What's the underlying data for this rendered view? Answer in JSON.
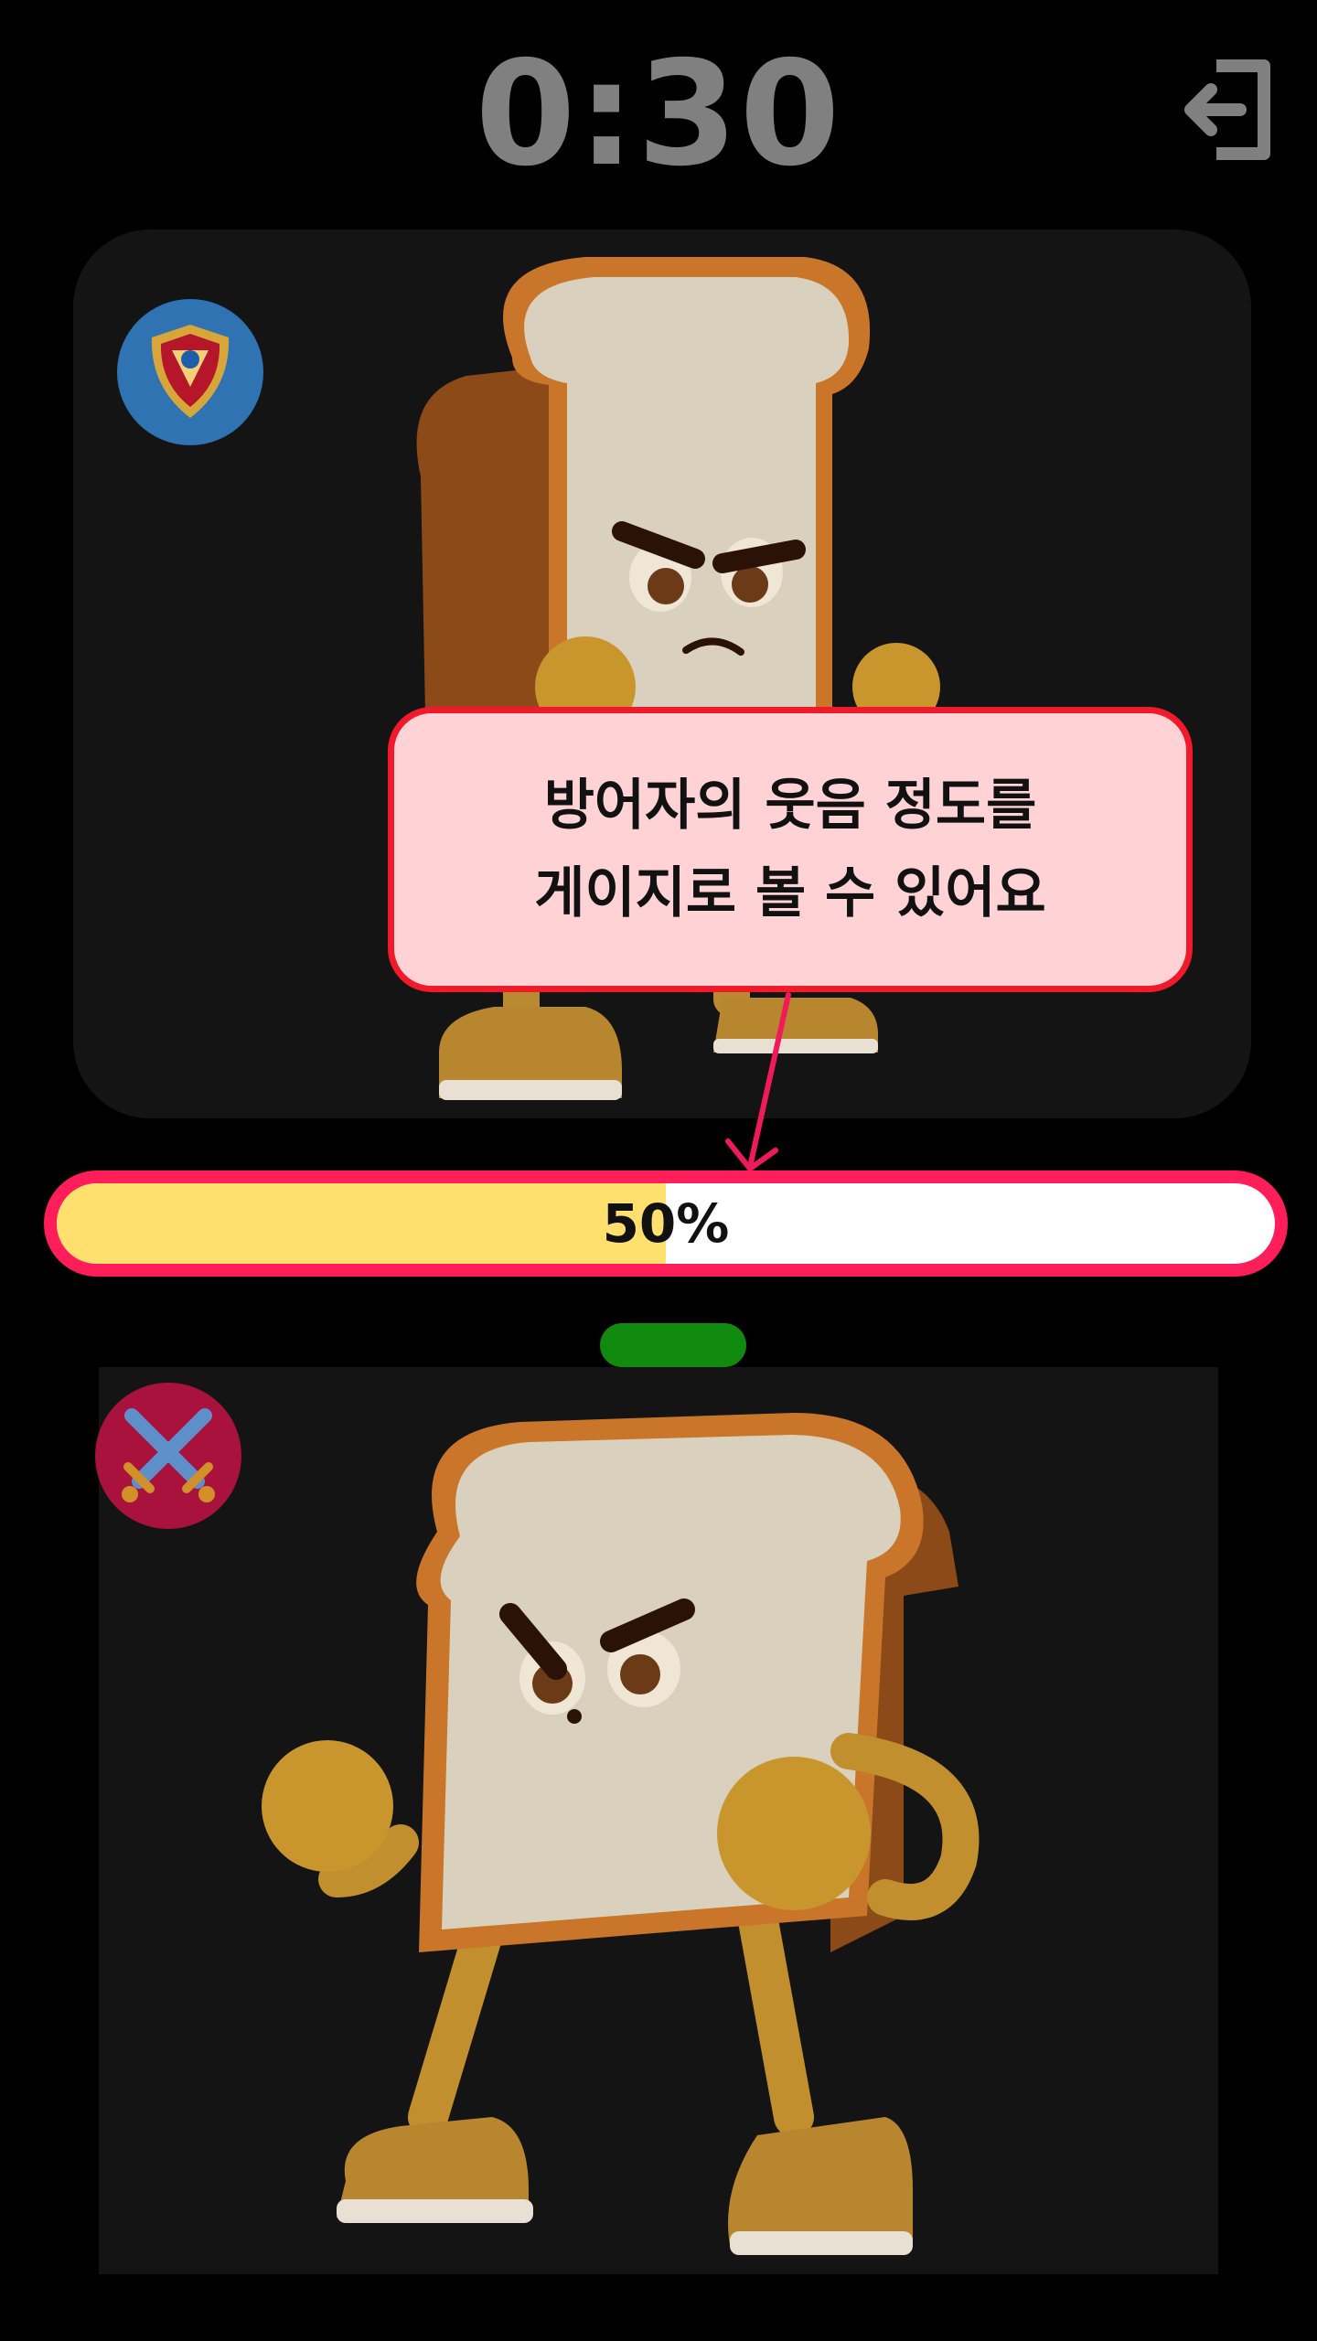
{
  "timer": {
    "value": "0:30"
  },
  "tooltip": {
    "line1": "방어자의 웃음 정도를",
    "line2": "게이지로 볼 수 있어요"
  },
  "gauge": {
    "percent_label": "50%",
    "fill_fraction": 0.5
  },
  "icons": {
    "exit": "exit-icon",
    "defender_badge": "shield-icon",
    "attacker_badge": "crossed-swords-icon",
    "character": "angry-bread-character"
  },
  "colors": {
    "background": "#000000",
    "timer_text": "#808080",
    "card": "#141414",
    "gauge_border": "#ff1e5a",
    "gauge_fill": "#ffdf6e",
    "tooltip_bg": "#ffd3d6",
    "tooltip_border": "#f01a2b",
    "defender_badge": "#2f73b3",
    "attacker_badge": "#a8123d",
    "handle": "#118a10"
  }
}
